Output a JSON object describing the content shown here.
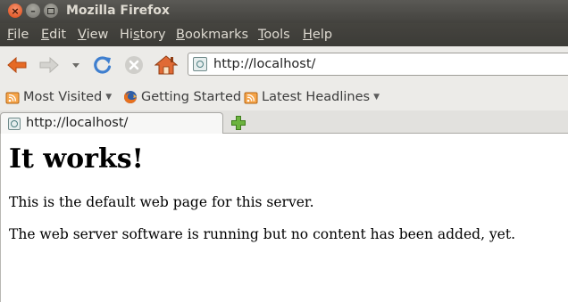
{
  "window": {
    "title": "Mozilla Firefox"
  },
  "menu": [
    {
      "key": "F",
      "rest": "ile"
    },
    {
      "key": "E",
      "rest": "dit"
    },
    {
      "key": "V",
      "rest": "iew"
    },
    {
      "pre": "Hi",
      "key": "s",
      "rest": "tory"
    },
    {
      "key": "B",
      "rest": "ookmarks"
    },
    {
      "key": "T",
      "rest": "ools"
    },
    {
      "key": "H",
      "rest": "elp"
    }
  ],
  "navigation": {
    "url": "http://localhost/"
  },
  "bookmarks": [
    {
      "label": "Most Visited",
      "icon": "rss-folder-icon",
      "dropdown": true
    },
    {
      "label": "Getting Started",
      "icon": "firefox-icon",
      "dropdown": false
    },
    {
      "label": "Latest Headlines",
      "icon": "rss-folder-icon",
      "dropdown": true
    }
  ],
  "tabs": [
    {
      "label": "http://localhost/",
      "active": true
    }
  ],
  "page": {
    "heading": "It works!",
    "paragraphs": [
      "This is the default web page for this server.",
      "The web server software is running but no content has been added, yet."
    ]
  },
  "colors": {
    "accent_orange": "#e66a25",
    "reload_blue": "#3f7fcf",
    "newtab_green": "#6cb33f"
  }
}
